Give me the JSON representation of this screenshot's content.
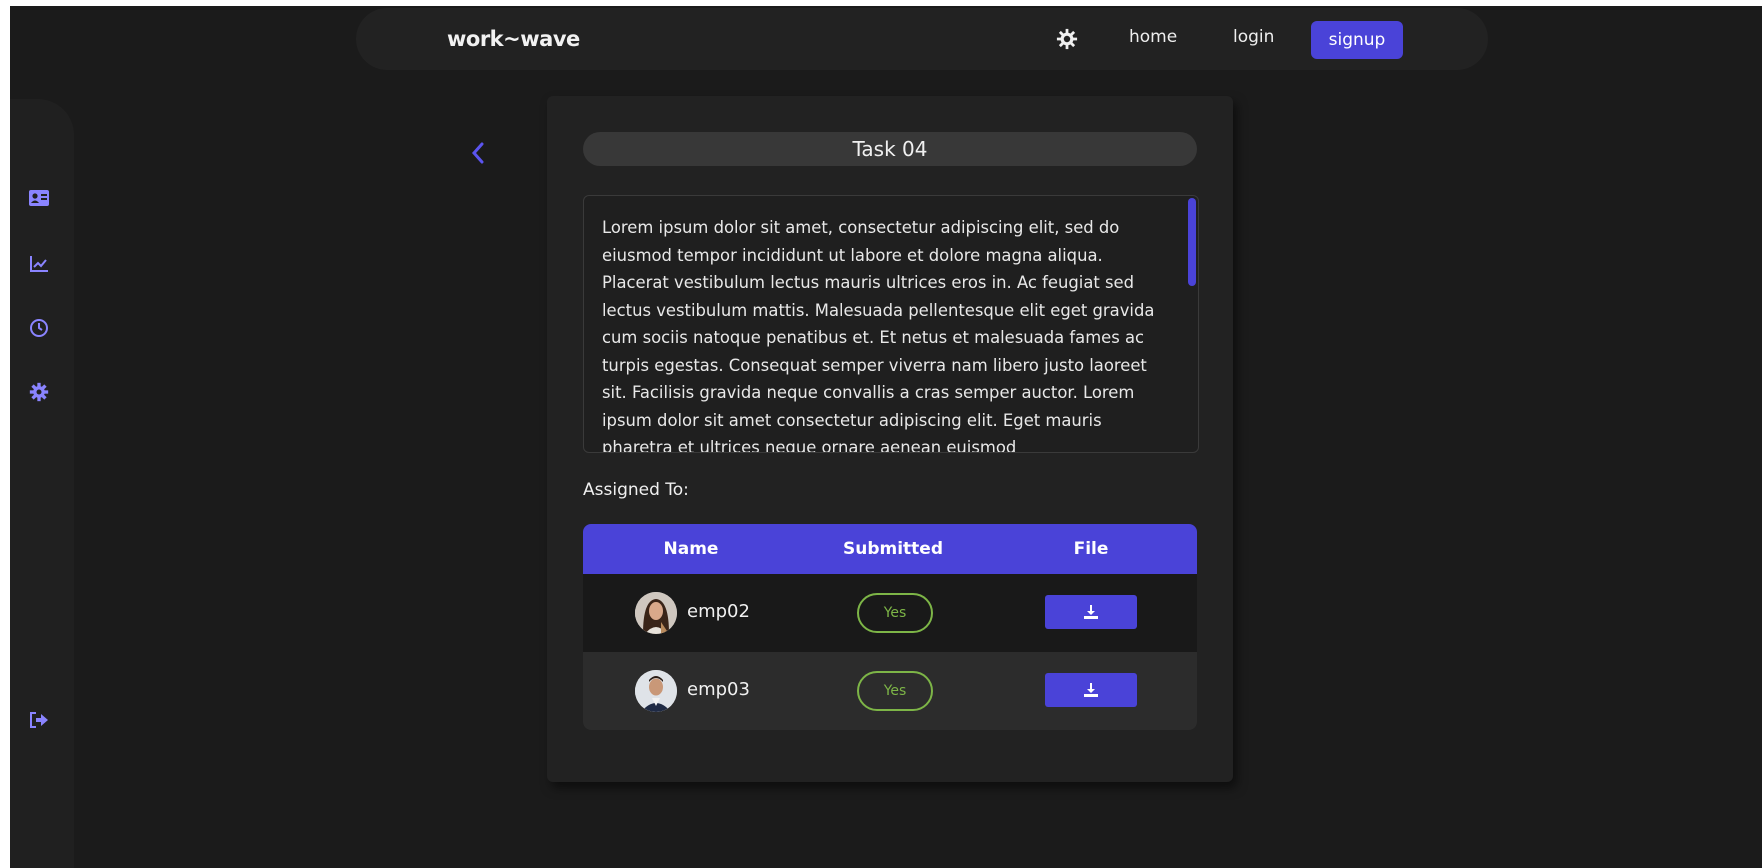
{
  "navbar": {
    "brand": "work~wave",
    "links": {
      "home": "home",
      "login": "login",
      "signup": "signup"
    },
    "theme_icon": "gear-sun-icon"
  },
  "sidebar": {
    "items": [
      {
        "icon": "id-card-icon"
      },
      {
        "icon": "chart-line-icon"
      },
      {
        "icon": "clock-icon"
      },
      {
        "icon": "gear-icon"
      }
    ],
    "logout_icon": "logout-icon"
  },
  "task": {
    "title": "Task 04",
    "description": "Lorem ipsum dolor sit amet, consectetur adipiscing elit, sed do eiusmod tempor incididunt ut labore et dolore magna aliqua. Placerat vestibulum lectus mauris ultrices eros in. Ac feugiat sed lectus vestibulum mattis. Malesuada pellentesque elit eget gravida cum sociis natoque penatibus et. Et netus et malesuada fames ac turpis egestas. Consequat semper viverra nam libero justo laoreet sit. Facilisis gravida neque convallis a cras semper auctor. Lorem ipsum dolor sit amet consectetur adipiscing elit. Eget mauris pharetra et ultrices neque ornare aenean euismod"
  },
  "assignees": {
    "label": "Assigned To:",
    "columns": [
      "Name",
      "Submitted",
      "File"
    ],
    "rows": [
      {
        "name": "emp02",
        "submitted": "Yes",
        "file_icon": "download-icon"
      },
      {
        "name": "emp03",
        "submitted": "Yes",
        "file_icon": "download-icon"
      }
    ]
  },
  "colors": {
    "accent": "#4a43d8",
    "background": "#1b1b1b",
    "card": "#222222",
    "status_yes": "#7db547"
  }
}
